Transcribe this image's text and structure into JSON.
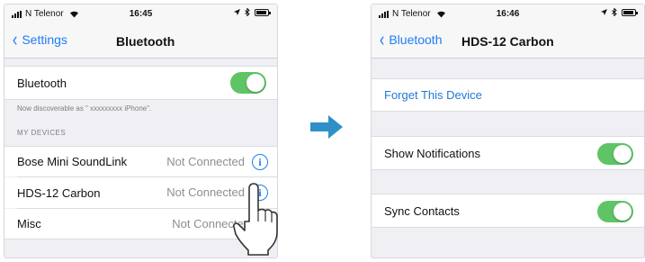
{
  "colors": {
    "ios_blue": "#1f7ef6",
    "switch_green": "#5fc465",
    "group_bg": "#efeff4",
    "arrow": "#2e90c8"
  },
  "left": {
    "status": {
      "carrier": "N Telenor",
      "time": "16:45"
    },
    "nav": {
      "back_label": "Settings",
      "title": "Bluetooth"
    },
    "bluetooth_row": {
      "label": "Bluetooth",
      "toggle_on": true
    },
    "discoverable_text": "Now discoverable as \" xxxxxxxxx iPhone\".",
    "section_header": "MY DEVICES",
    "devices": [
      {
        "name": "Bose Mini SoundLink",
        "status": "Not Connected"
      },
      {
        "name": "HDS-12 Carbon",
        "status": "Not Connected"
      },
      {
        "name": "Misc",
        "status": "Not Connected"
      }
    ]
  },
  "right": {
    "status": {
      "carrier": "N Telenor",
      "time": "16:46"
    },
    "nav": {
      "back_label": "Bluetooth",
      "title": "HDS-12 Carbon"
    },
    "forget_label": "Forget This Device",
    "rows": [
      {
        "label": "Show Notifications",
        "toggle_on": true
      },
      {
        "label": "Sync Contacts",
        "toggle_on": true
      }
    ]
  },
  "icons": {
    "info": "info-circle-icon",
    "arrow": "right-arrow-icon",
    "hand": "pointing-hand-icon",
    "wifi": "wifi-icon",
    "bluetooth": "bluetooth-icon",
    "battery": "battery-icon",
    "signal": "signal-icon",
    "location": "location-icon"
  }
}
